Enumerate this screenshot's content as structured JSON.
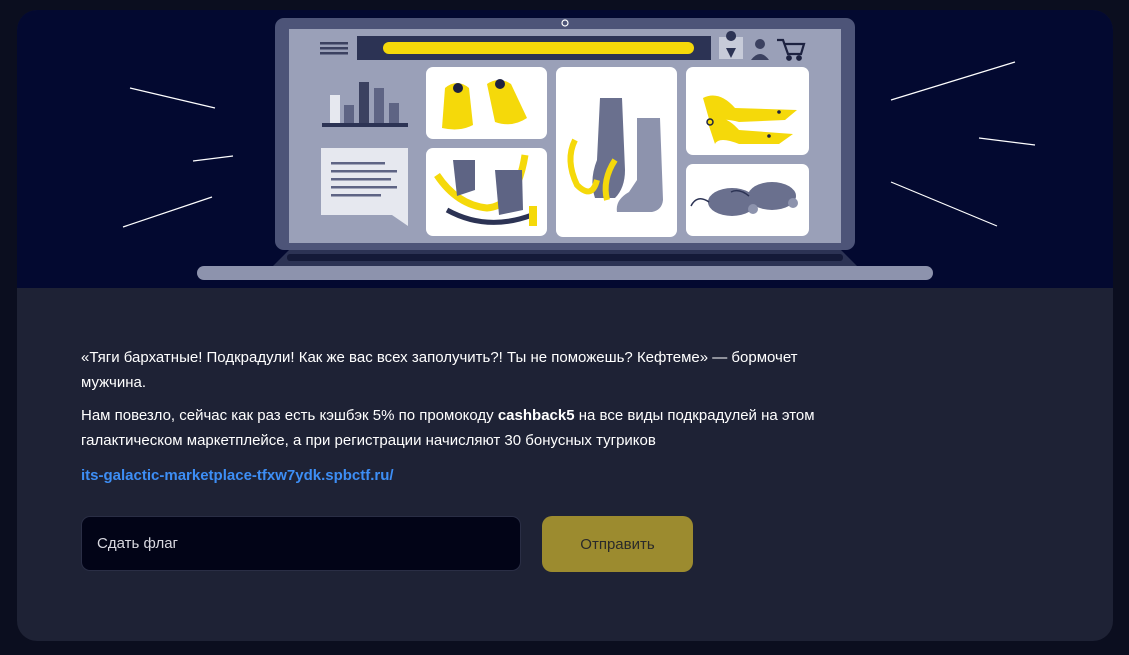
{
  "story": {
    "quote_line": "«Тяги бархатные! Подкрадули! Как же вас всех заполучить?! Ты не поможешь? Кефтеме» — бормочет мужчина.",
    "promo_before": "Нам повезло, сейчас как раз есть кэшбэк 5% по промокоду ",
    "promo_code": "cashback5",
    "promo_after": " на все виды подкрадулей на этом галактическом маркетплейсе, а при регистрации начисляют 30 бонусных тугриков",
    "link_text": "its-galactic-marketplace-tfxw7ydk.spbctf.ru/"
  },
  "form": {
    "flag_placeholder": "Сдать флаг",
    "submit_label": "Отправить"
  },
  "colors": {
    "hero_bg": "#030930",
    "card_bg": "#1e2235",
    "accent_yellow": "#f5d90a",
    "link_blue": "#3d8ef5",
    "button_bg": "#9c8b2f"
  },
  "icons": [
    "menu-icon",
    "location-pin-icon",
    "user-icon",
    "cart-icon",
    "bar-chart-icon",
    "chat-bubble-icon"
  ]
}
